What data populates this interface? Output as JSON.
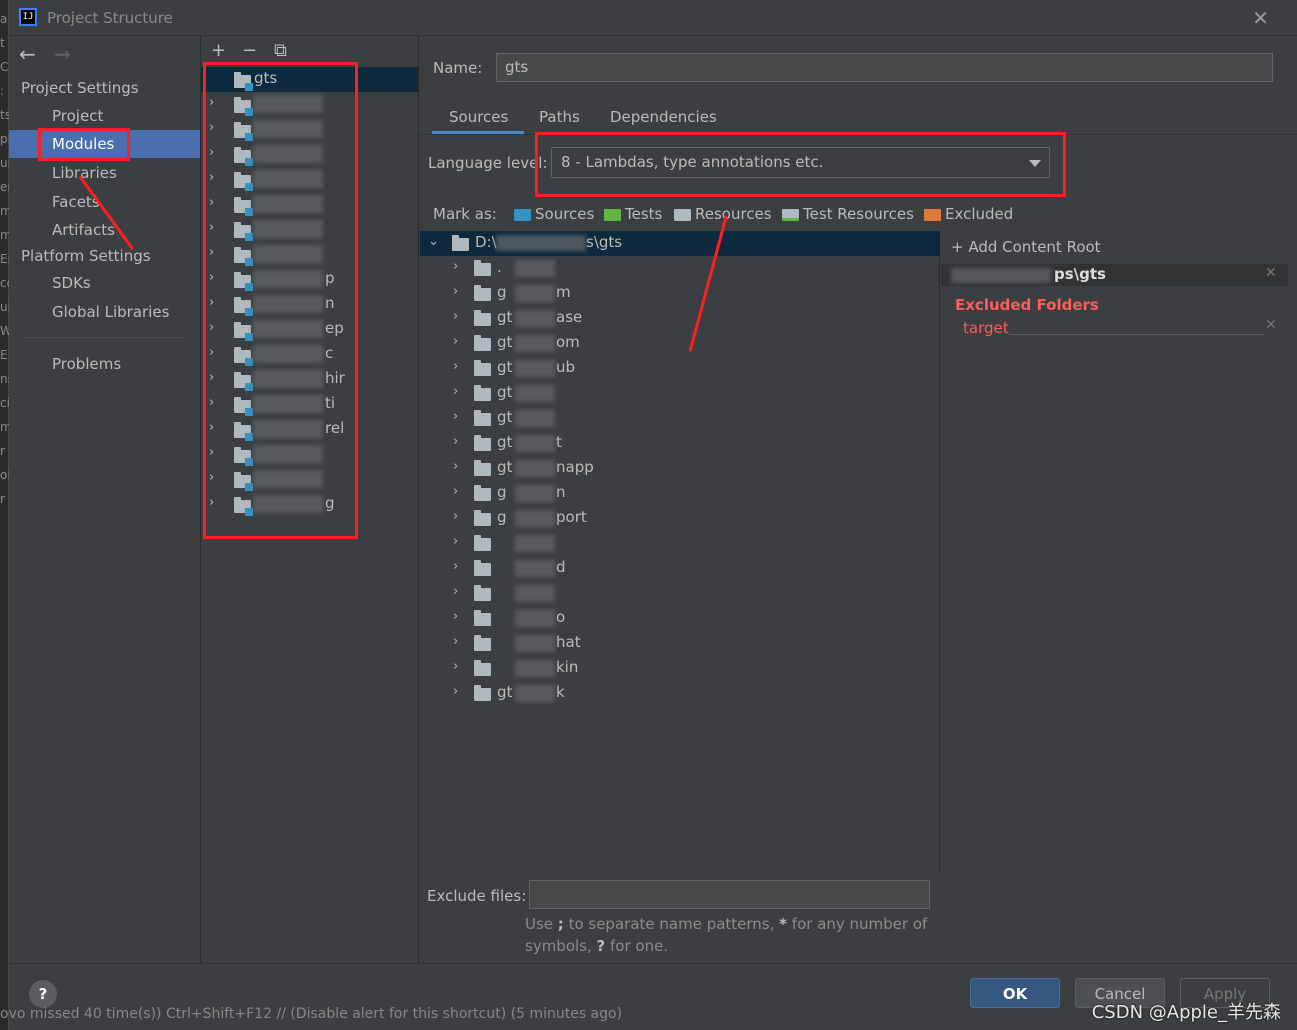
{
  "window": {
    "title": "Project Structure"
  },
  "nav": {
    "back": "←",
    "forward": "→"
  },
  "sidebar": {
    "project_settings": "Project Settings",
    "items_ps": [
      "Project",
      "Modules",
      "Libraries",
      "Facets",
      "Artifacts"
    ],
    "platform_settings": "Platform Settings",
    "items_plat": [
      "SDKs",
      "Global Libraries"
    ],
    "problems": "Problems"
  },
  "modules": {
    "toolbar": {
      "add": "+",
      "remove": "−",
      "copy": "⧉"
    },
    "root_name": "gts",
    "rows": [
      "",
      "",
      "",
      "",
      "",
      "",
      "",
      "p",
      "n",
      "ep",
      "c",
      "hir",
      "ti",
      "rel",
      "",
      "",
      "g"
    ],
    "last_suffix": "k"
  },
  "main": {
    "name_label": "Name:",
    "name_value": "gts",
    "tabs": [
      "Sources",
      "Paths",
      "Dependencies"
    ],
    "language_level_label": "Language level:",
    "language_level_value": "8 - Lambdas, type annotations etc.",
    "mark_as_label": "Mark as:",
    "mark_as": [
      {
        "label": "Sources",
        "color": "#3592c4"
      },
      {
        "label": "Tests",
        "color": "#62b543"
      },
      {
        "label": "Resources",
        "color": "#aeb9c0"
      },
      {
        "label": "Test Resources",
        "color": "#aeb9c0"
      },
      {
        "label": "Excluded",
        "color": "#e07a3c"
      }
    ],
    "tree_root_prefix": "D:\\",
    "tree_root_suffix": "s\\gts",
    "tree_rows": [
      ".",
      "g",
      "gt",
      "gt",
      "gt",
      "gt",
      "gt",
      "gt",
      "gt",
      "g",
      "g",
      "",
      "",
      "",
      "",
      "",
      "",
      "gt"
    ],
    "tree_suffixes": [
      "",
      "m",
      "ase",
      "om",
      "ub",
      "",
      "",
      "t",
      "napp",
      "n",
      "port",
      "",
      "d",
      "",
      "o",
      "hat",
      "kin",
      "k"
    ],
    "add_content_root": "Add Content Root",
    "content_root_path": "ps\\gts",
    "excluded_folders_title": "Excluded Folders",
    "excluded_folders": [
      "target"
    ],
    "exclude_files_label": "Exclude files:",
    "exclude_files_value": "",
    "hint_parts": {
      "use": "Use ",
      "semi": ";",
      "mid": " to separate name patterns, ",
      "star": "*",
      "mid2": " for any number of symbols, ",
      "q": "?",
      "end": " for one."
    }
  },
  "buttons": {
    "help": "?",
    "ok": "OK",
    "cancel": "Cancel",
    "apply": "Apply"
  },
  "status_text": "ovo missed 40 time(s)) Ctrl+Shift+F12 // (Disable alert for this shortcut) (5 minutes ago)",
  "watermark": "CSDN @Apple_羊先森",
  "left_edge_chars": [
    "a",
    "t",
    "C",
    ":",
    "ts",
    "pE",
    "un",
    "er",
    "m",
    "m",
    "Er",
    "co",
    "ui",
    "W",
    "E",
    "ns",
    "ci",
    "m",
    "r",
    "oi",
    "r"
  ]
}
